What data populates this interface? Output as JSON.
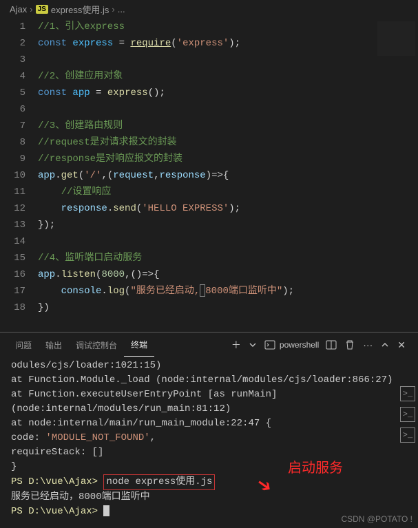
{
  "breadcrumb": {
    "folder": "Ajax",
    "file": "express使用.js",
    "ellipsis": "..."
  },
  "lines": [
    "1",
    "2",
    "3",
    "4",
    "5",
    "6",
    "7",
    "8",
    "9",
    "10",
    "11",
    "12",
    "13",
    "14",
    "15",
    "16",
    "17",
    "18"
  ],
  "code": {
    "l1_comment": "//1、引入express",
    "l2_const": "const",
    "l2_var": "express",
    "l2_eq": " = ",
    "l2_fn": "require",
    "l2_str": "'express'",
    "l4_comment": "//2、创建应用对象",
    "l5_const": "const",
    "l5_var": "app",
    "l5_eq": " = ",
    "l5_fn": "express",
    "l7_comment": "//3、创建路由规则",
    "l8_comment": "//request是对请求报文的封装",
    "l9_comment": "//response是对响应报文的封装",
    "l10_app": "app",
    "l10_get": "get",
    "l10_path": "'/'",
    "l10_req": "request",
    "l10_res": "response",
    "l11_comment": "//设置响应",
    "l12_res": "response",
    "l12_send": "send",
    "l12_str": "'HELLO EXPRESS'",
    "l15_comment": "//4、监听端口启动服务",
    "l16_app": "app",
    "l16_listen": "listen",
    "l16_port": "8000",
    "l17_console": "console",
    "l17_log": "log",
    "l17_str1": "\"服务已经启动,",
    "l17_str2": "8000端口监听中\""
  },
  "panel": {
    "tab_problems": "问题",
    "tab_output": "输出",
    "tab_debug": "调试控制台",
    "tab_terminal": "终端",
    "shell": "powershell"
  },
  "terminal": {
    "t1": "odules/cjs/loader:1021:15)",
    "t2": "    at Function.Module._load (node:internal/modules/cjs/loader:866:27)",
    "t3": "    at Function.executeUserEntryPoint [as runMain] (node:internal/modules/run_main:81:12)",
    "t4": "    at node:internal/main/run_main_module:22:47 {",
    "t5_key": "  code: ",
    "t5_val": "'MODULE_NOT_FOUND'",
    "t5_end": ",",
    "t6": "  requireStack: []",
    "t7": "}",
    "p1": "PS D:\\vue\\Ajax>",
    "cmd": "node express使用.js",
    "out": "服务已经启动，8000端口监听中",
    "p2": "PS D:\\vue\\Ajax>"
  },
  "annotation": "启动服务",
  "watermark": "CSDN @POTATO !"
}
